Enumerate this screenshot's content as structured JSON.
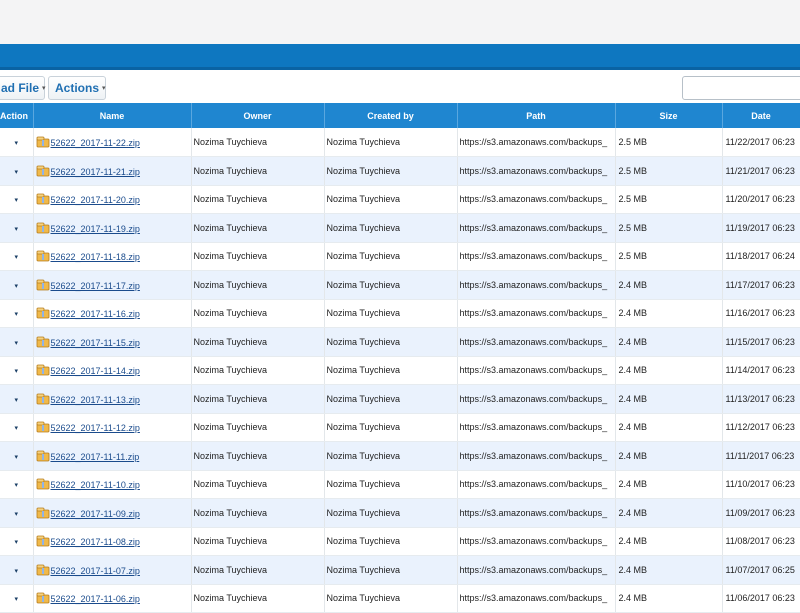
{
  "toolbar": {
    "upload_label": "ad File",
    "actions_label": "Actions",
    "caret": "▾"
  },
  "search": {
    "placeholder": "",
    "value": ""
  },
  "columns": {
    "action": "Action",
    "name": "Name",
    "owner": "Owner",
    "created_by": "Created by",
    "path": "Path",
    "size": "Size",
    "date": "Date"
  },
  "icons": {
    "row_action": "dropdown-caret-icon",
    "file": "zip-archive-icon"
  },
  "colors": {
    "header_bg": "#1f86d0",
    "top_bar": "#0e77c0",
    "row_alt": "#eaf2fd",
    "link": "#1a4b8c"
  },
  "rows": [
    {
      "name": "52622_2017-11-22.zip",
      "owner": "Nozima Tuychieva",
      "created_by": "Nozima Tuychieva",
      "path": "https://s3.amazonaws.com/backups_",
      "size": "2.5 MB",
      "date": "11/22/2017 06:23"
    },
    {
      "name": "52622_2017-11-21.zip",
      "owner": "Nozima Tuychieva",
      "created_by": "Nozima Tuychieva",
      "path": "https://s3.amazonaws.com/backups_",
      "size": "2.5 MB",
      "date": "11/21/2017 06:23"
    },
    {
      "name": "52622_2017-11-20.zip",
      "owner": "Nozima Tuychieva",
      "created_by": "Nozima Tuychieva",
      "path": "https://s3.amazonaws.com/backups_",
      "size": "2.5 MB",
      "date": "11/20/2017 06:23"
    },
    {
      "name": "52622_2017-11-19.zip",
      "owner": "Nozima Tuychieva",
      "created_by": "Nozima Tuychieva",
      "path": "https://s3.amazonaws.com/backups_",
      "size": "2.5 MB",
      "date": "11/19/2017 06:23"
    },
    {
      "name": "52622_2017-11-18.zip",
      "owner": "Nozima Tuychieva",
      "created_by": "Nozima Tuychieva",
      "path": "https://s3.amazonaws.com/backups_",
      "size": "2.5 MB",
      "date": "11/18/2017 06:24"
    },
    {
      "name": "52622_2017-11-17.zip",
      "owner": "Nozima Tuychieva",
      "created_by": "Nozima Tuychieva",
      "path": "https://s3.amazonaws.com/backups_",
      "size": "2.4 MB",
      "date": "11/17/2017 06:23"
    },
    {
      "name": "52622_2017-11-16.zip",
      "owner": "Nozima Tuychieva",
      "created_by": "Nozima Tuychieva",
      "path": "https://s3.amazonaws.com/backups_",
      "size": "2.4 MB",
      "date": "11/16/2017 06:23"
    },
    {
      "name": "52622_2017-11-15.zip",
      "owner": "Nozima Tuychieva",
      "created_by": "Nozima Tuychieva",
      "path": "https://s3.amazonaws.com/backups_",
      "size": "2.4 MB",
      "date": "11/15/2017 06:23"
    },
    {
      "name": "52622_2017-11-14.zip",
      "owner": "Nozima Tuychieva",
      "created_by": "Nozima Tuychieva",
      "path": "https://s3.amazonaws.com/backups_",
      "size": "2.4 MB",
      "date": "11/14/2017 06:23"
    },
    {
      "name": "52622_2017-11-13.zip",
      "owner": "Nozima Tuychieva",
      "created_by": "Nozima Tuychieva",
      "path": "https://s3.amazonaws.com/backups_",
      "size": "2.4 MB",
      "date": "11/13/2017 06:23"
    },
    {
      "name": "52622_2017-11-12.zip",
      "owner": "Nozima Tuychieva",
      "created_by": "Nozima Tuychieva",
      "path": "https://s3.amazonaws.com/backups_",
      "size": "2.4 MB",
      "date": "11/12/2017 06:23"
    },
    {
      "name": "52622_2017-11-11.zip",
      "owner": "Nozima Tuychieva",
      "created_by": "Nozima Tuychieva",
      "path": "https://s3.amazonaws.com/backups_",
      "size": "2.4 MB",
      "date": "11/11/2017 06:23"
    },
    {
      "name": "52622_2017-11-10.zip",
      "owner": "Nozima Tuychieva",
      "created_by": "Nozima Tuychieva",
      "path": "https://s3.amazonaws.com/backups_",
      "size": "2.4 MB",
      "date": "11/10/2017 06:23"
    },
    {
      "name": "52622_2017-11-09.zip",
      "owner": "Nozima Tuychieva",
      "created_by": "Nozima Tuychieva",
      "path": "https://s3.amazonaws.com/backups_",
      "size": "2.4 MB",
      "date": "11/09/2017 06:23"
    },
    {
      "name": "52622_2017-11-08.zip",
      "owner": "Nozima Tuychieva",
      "created_by": "Nozima Tuychieva",
      "path": "https://s3.amazonaws.com/backups_",
      "size": "2.4 MB",
      "date": "11/08/2017 06:23"
    },
    {
      "name": "52622_2017-11-07.zip",
      "owner": "Nozima Tuychieva",
      "created_by": "Nozima Tuychieva",
      "path": "https://s3.amazonaws.com/backups_",
      "size": "2.4 MB",
      "date": "11/07/2017 06:25"
    },
    {
      "name": "52622_2017-11-06.zip",
      "owner": "Nozima Tuychieva",
      "created_by": "Nozima Tuychieva",
      "path": "https://s3.amazonaws.com/backups_",
      "size": "2.4 MB",
      "date": "11/06/2017 06:23"
    }
  ]
}
